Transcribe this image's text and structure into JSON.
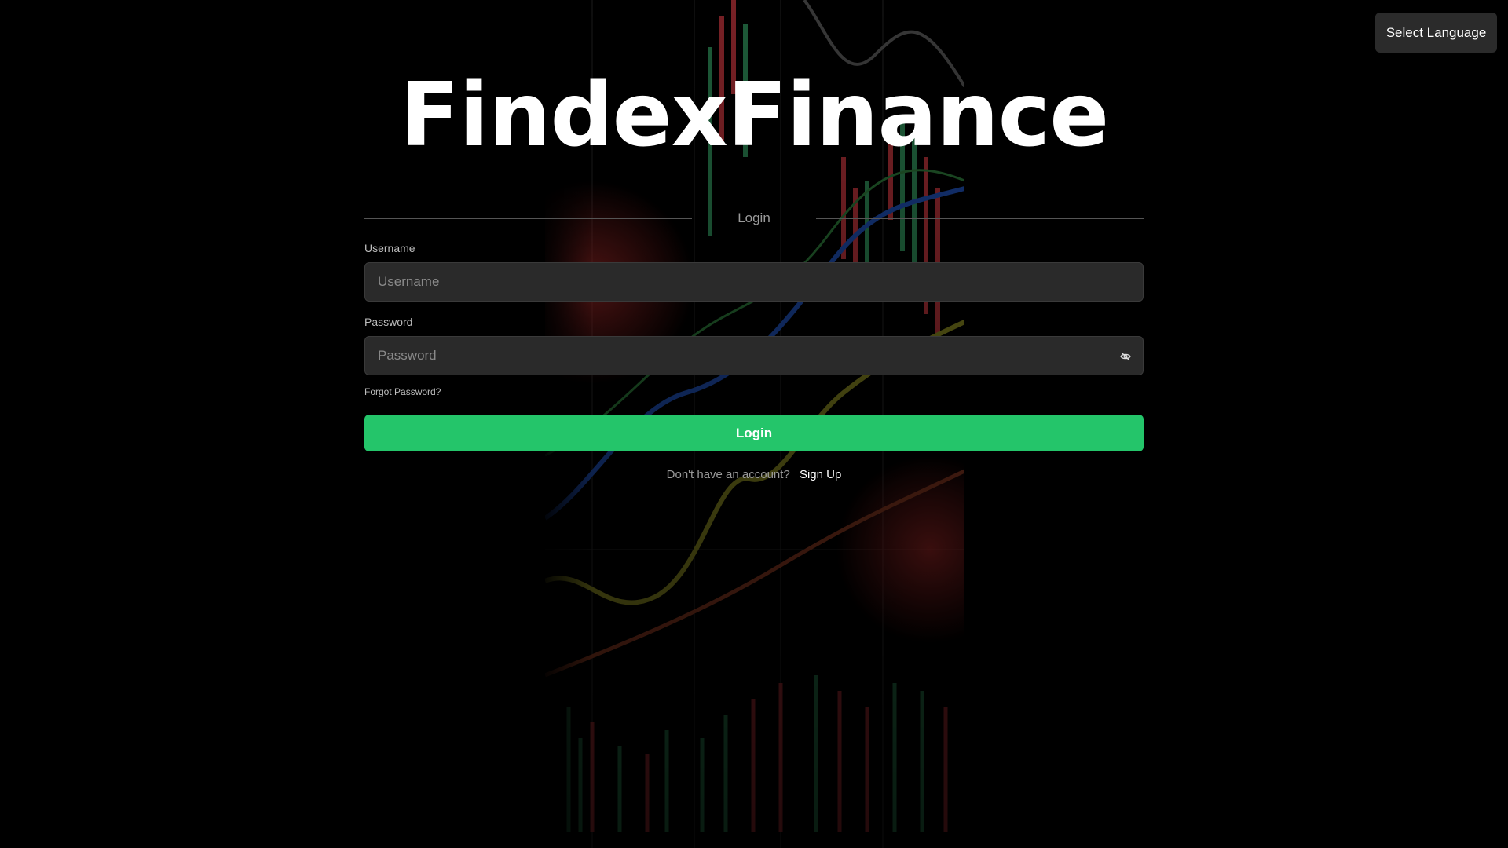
{
  "header": {
    "language_button": "Select Language"
  },
  "brand": {
    "logo_text": "FindexFinance"
  },
  "login_form": {
    "section_title": "Login",
    "username": {
      "label": "Username",
      "placeholder": "Username",
      "value": ""
    },
    "password": {
      "label": "Password",
      "placeholder": "Password",
      "value": ""
    },
    "forgot_password": "Forgot Password?",
    "submit_label": "Login",
    "signup_prompt": "Don't have an account?",
    "signup_link": "Sign Up"
  },
  "colors": {
    "accent": "#24c56a",
    "background": "#000000",
    "input_background": "#2a2a2a"
  },
  "icons": {
    "password_toggle": "eye-slash-icon"
  }
}
